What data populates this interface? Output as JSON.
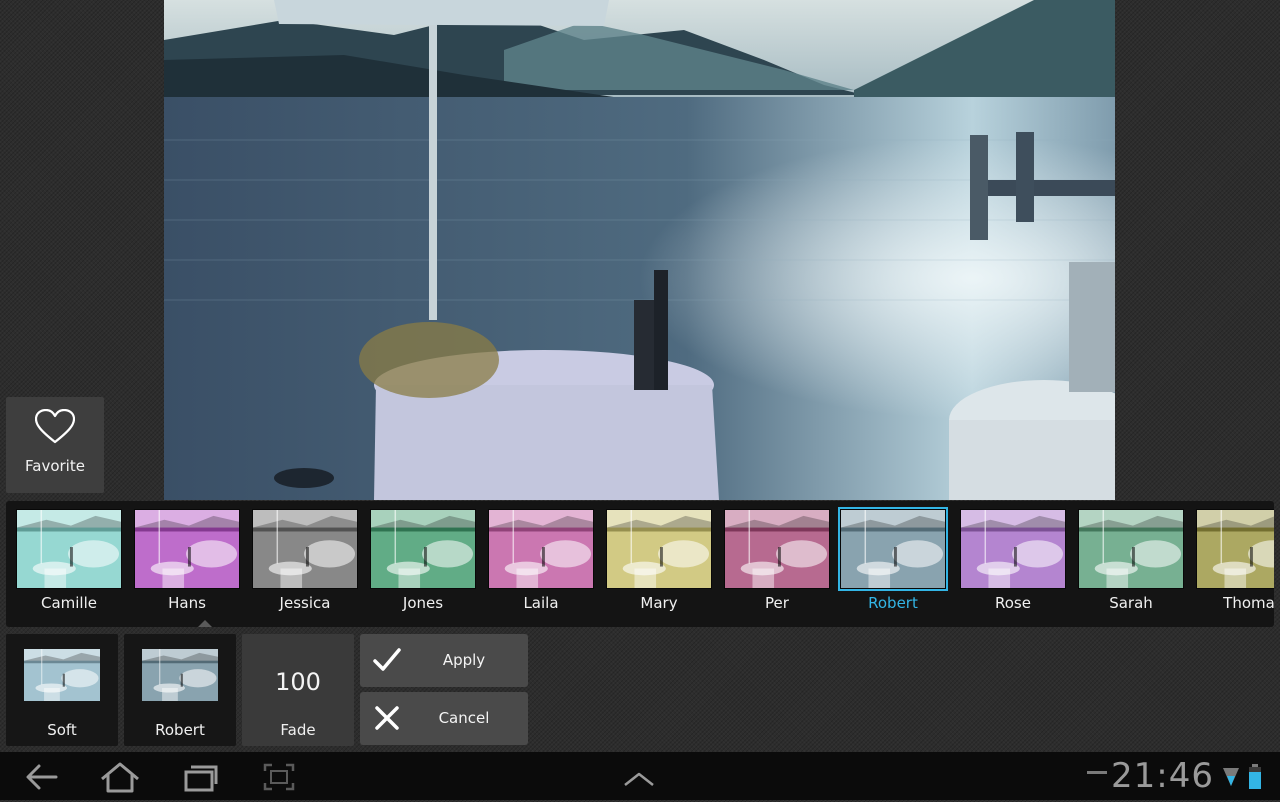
{
  "favorite": {
    "label": "Favorite",
    "icon": "heart-outline-icon"
  },
  "filters": [
    {
      "name": "Camille",
      "tint": "#7fd0c8",
      "selected": false
    },
    {
      "name": "Hans",
      "tint": "#b04dc0",
      "selected": false
    },
    {
      "name": "Jessica",
      "tint": "#6e6e6e",
      "selected": false
    },
    {
      "name": "Jones",
      "tint": "#3f9a6c",
      "selected": false
    },
    {
      "name": "Laila",
      "tint": "#c05aa0",
      "selected": false
    },
    {
      "name": "Mary",
      "tint": "#c8bf6a",
      "selected": false
    },
    {
      "name": "Per",
      "tint": "#a84a78",
      "selected": false
    },
    {
      "name": "Robert",
      "tint": "#6f8f9e",
      "selected": true
    },
    {
      "name": "Rose",
      "tint": "#a46bc6",
      "selected": false
    },
    {
      "name": "Sarah",
      "tint": "#5a9f7a",
      "selected": false
    },
    {
      "name": "Thoma",
      "tint": "#9a9540",
      "selected": false
    }
  ],
  "controls": {
    "soft_label": "Soft",
    "robert_label": "Robert",
    "fade_value": "100",
    "fade_label": "Fade",
    "apply_label": "Apply",
    "cancel_label": "Cancel"
  },
  "system_bar": {
    "time": "21:46",
    "back_icon": "back-arrow-icon",
    "home_icon": "home-icon",
    "recents_icon": "recent-apps-icon",
    "screenshot_icon": "screenshot-icon",
    "menu_icon": "chevron-up-icon"
  },
  "colors": {
    "accent": "#33b5e5"
  }
}
